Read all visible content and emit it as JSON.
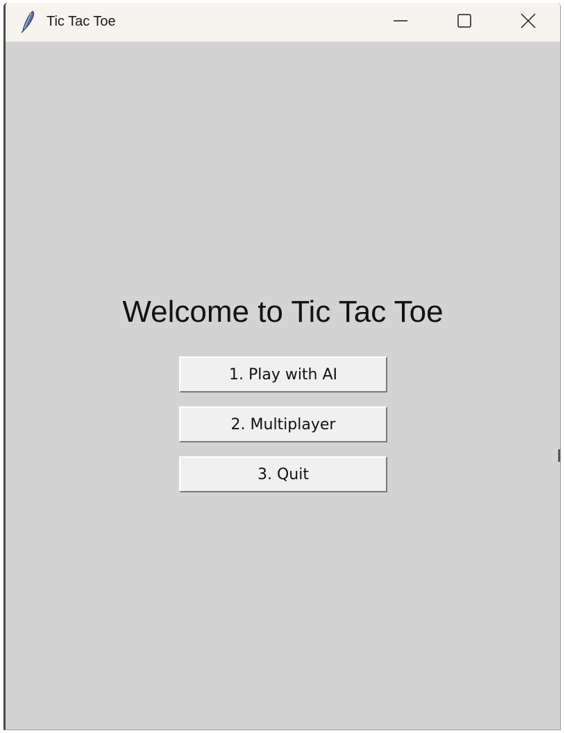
{
  "window": {
    "title": "Tic Tac Toe",
    "icon": "feather-icon",
    "controls": {
      "minimize_icon": "minimize-icon",
      "maximize_icon": "maximize-icon",
      "close_icon": "close-icon"
    }
  },
  "main": {
    "heading": "Welcome to Tic Tac Toe",
    "buttons": [
      {
        "label": "1. Play with AI"
      },
      {
        "label": "2. Multiplayer"
      },
      {
        "label": "3. Quit"
      }
    ]
  },
  "colors": {
    "background": "#d3d3d3",
    "titlebar": "#f7f3ee",
    "button_face": "#f0f0f0",
    "text": "#111111"
  }
}
